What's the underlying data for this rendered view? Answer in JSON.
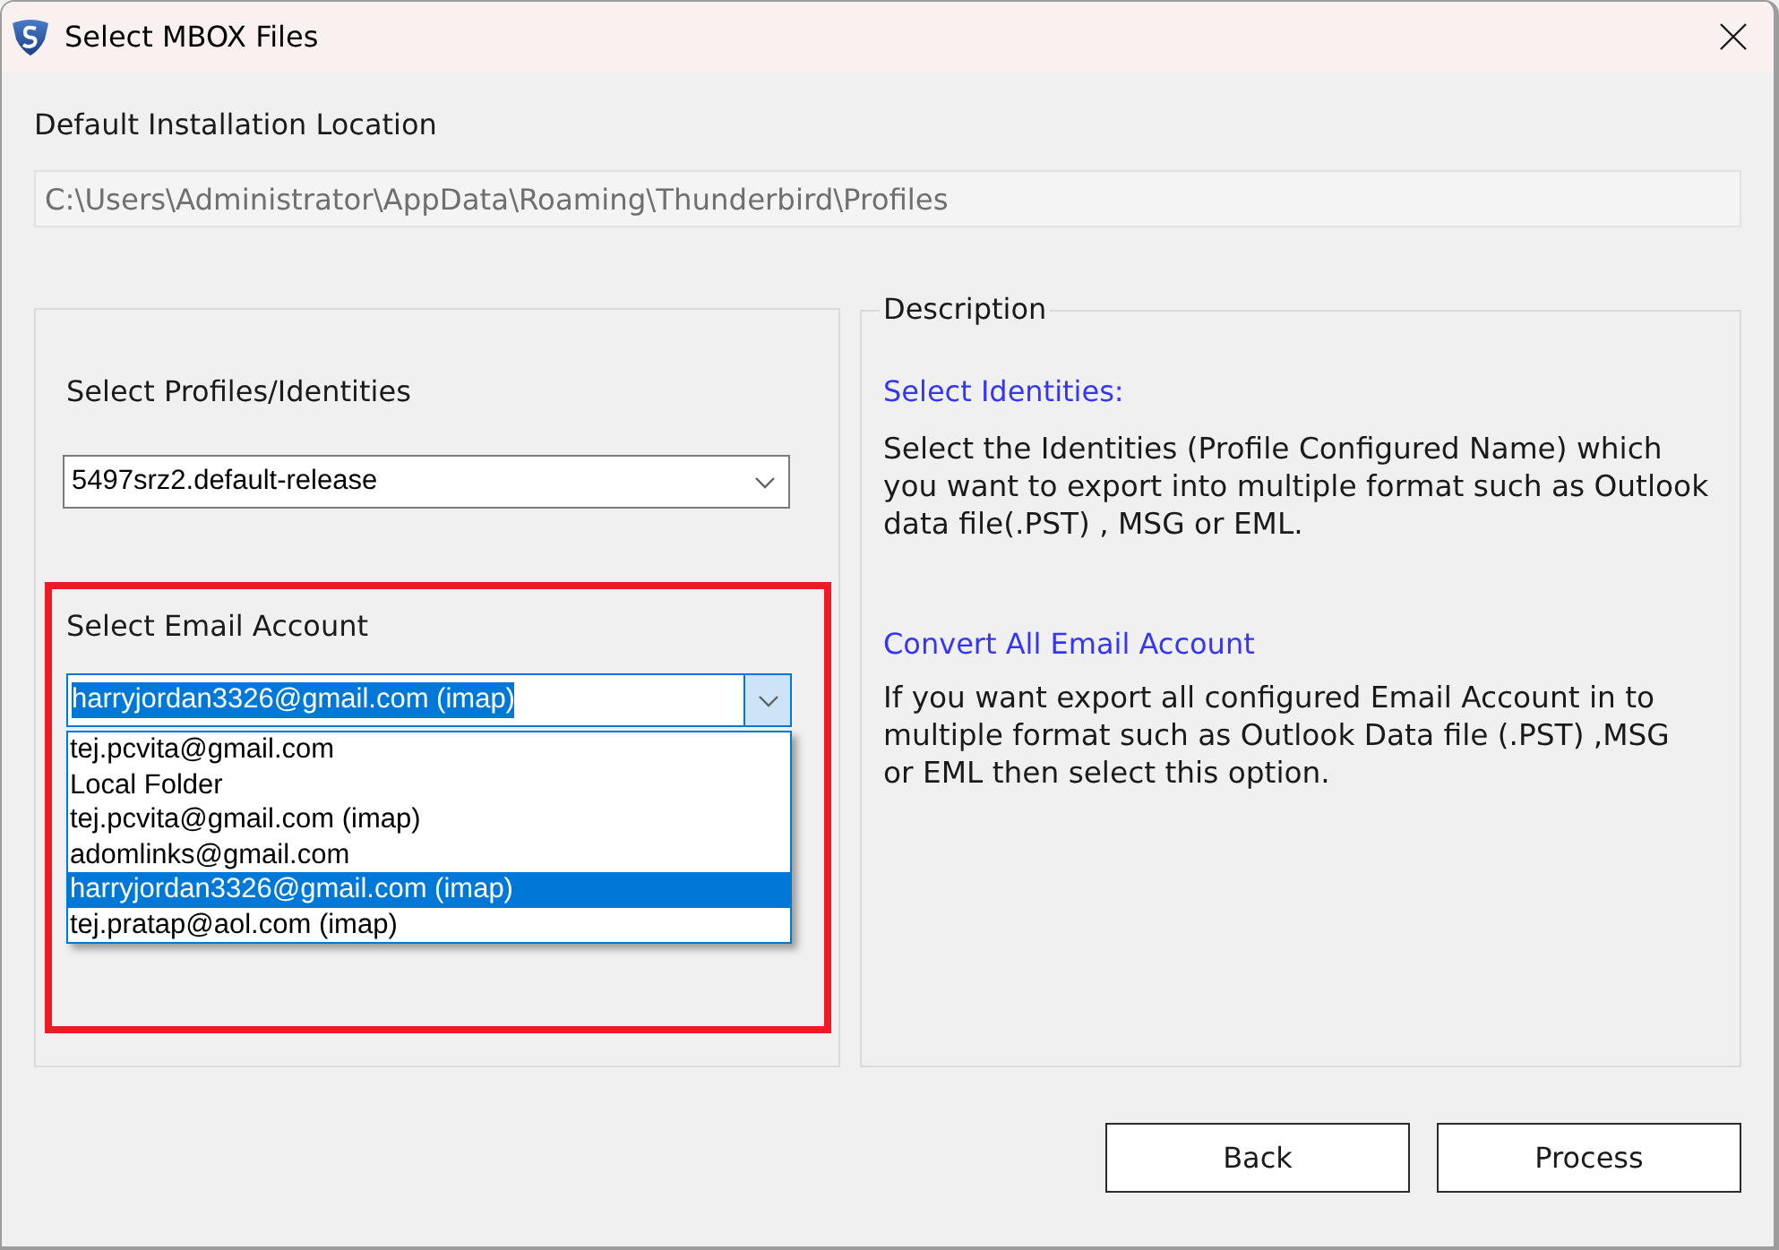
{
  "window": {
    "title": "Select MBOX Files"
  },
  "install_location": {
    "label": "Default Installation Location",
    "path": "C:\\Users\\Administrator\\AppData\\Roaming\\Thunderbird\\Profiles",
    "disabled": true
  },
  "profile": {
    "label": "Select Profiles/Identities",
    "value": "5497srz2.default-release"
  },
  "email_account": {
    "label": "Select Email Account",
    "highlight_frame": true,
    "value": "harryjordan3326@gmail.com (imap)",
    "text_selected": true,
    "expanded": true,
    "options": [
      {
        "label": "tej.pcvita@gmail.com",
        "selected": false
      },
      {
        "label": "Local Folder",
        "selected": false
      },
      {
        "label": "tej.pcvita@gmail.com (imap)",
        "selected": false
      },
      {
        "label": "adomlinks@gmail.com",
        "selected": false
      },
      {
        "label": "harryjordan3326@gmail.com (imap)",
        "selected": true
      },
      {
        "label": "tej.pratap@aol.com (imap)",
        "selected": false
      }
    ]
  },
  "description": {
    "title": "Description",
    "sections": [
      {
        "heading": "Select Identities:",
        "text": "Select the Identities (Profile Configured Name) which\nyou want to export into multiple format such as Outlook\ndata file(.PST) , MSG or EML."
      },
      {
        "heading": "Convert All Email Account",
        "text": "If you want export all configured Email Account in to\nmultiple format such as Outlook Data file (.PST) ,MSG\nor EML then select this option."
      }
    ]
  },
  "buttons": [
    {
      "label": "Back"
    },
    {
      "label": "Process"
    }
  ]
}
